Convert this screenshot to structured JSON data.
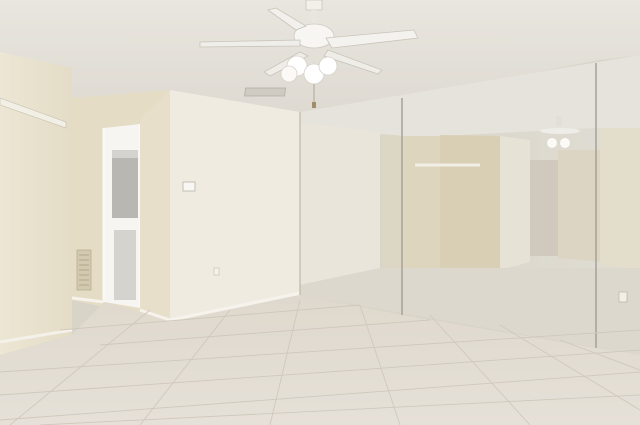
{
  "scene": {
    "kind": "empty-room-photo",
    "palette": {
      "ceiling": "#ece9e2",
      "wall_warm": "#e8e2d0",
      "wall_light": "#efebe1",
      "floor": "#e3ddd3",
      "grout": "#cfc8bc",
      "mirror_tint": "#d8d4c9",
      "fan_white": "#f4f2ee"
    },
    "objects": [
      "ceiling-fan-icon",
      "mirror-wall",
      "doorway",
      "thermostat",
      "wall-shelf",
      "floor-vent",
      "ceiling-vent",
      "tile-floor"
    ]
  }
}
